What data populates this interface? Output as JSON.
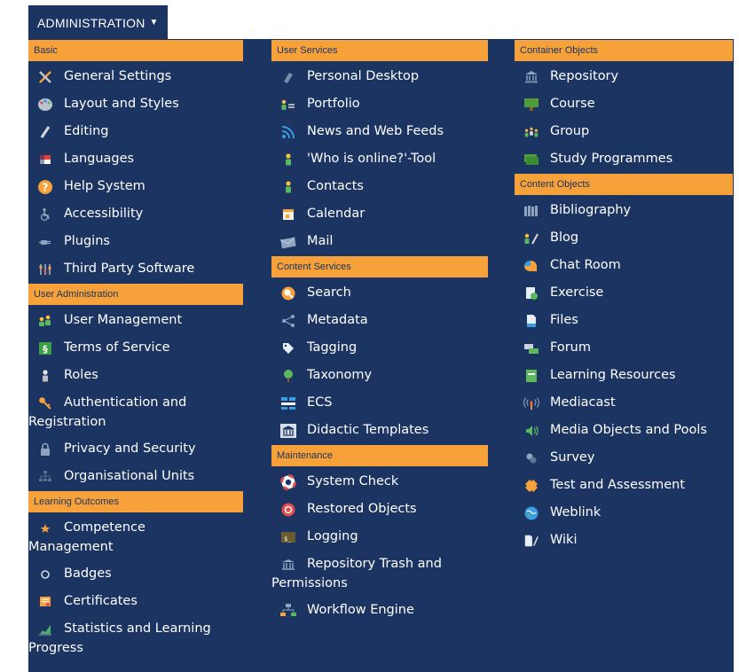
{
  "dropdown": {
    "label": "ADMINISTRATION"
  },
  "columns": [
    {
      "sections": [
        {
          "title": "Basic",
          "items": [
            {
              "label": "General Settings",
              "icon": "tools-icon"
            },
            {
              "label": "Layout and Styles",
              "icon": "palette-icon"
            },
            {
              "label": "Editing",
              "icon": "pencil-icon"
            },
            {
              "label": "Languages",
              "icon": "flag-icon"
            },
            {
              "label": "Help System",
              "icon": "help-icon"
            },
            {
              "label": "Accessibility",
              "icon": "accessibility-icon"
            },
            {
              "label": "Plugins",
              "icon": "plug-icon"
            },
            {
              "label": "Third Party Software",
              "icon": "sliders-icon"
            }
          ]
        },
        {
          "title": "User Administration",
          "items": [
            {
              "label": "User Management",
              "icon": "users-icon"
            },
            {
              "label": "Terms of Service",
              "icon": "section-icon"
            },
            {
              "label": "Roles",
              "icon": "role-icon"
            },
            {
              "label": "Authentication and",
              "cont": "Registration",
              "icon": "key-icon"
            },
            {
              "label": "Privacy and Security",
              "icon": "lock-icon"
            },
            {
              "label": "Organisational Units",
              "icon": "org-icon"
            }
          ]
        },
        {
          "title": "Learning Outcomes",
          "items": [
            {
              "label": "Competence",
              "cont": "Management",
              "icon": "star-icon"
            },
            {
              "label": "Badges",
              "icon": "badge-icon"
            },
            {
              "label": "Certificates",
              "icon": "certificate-icon"
            },
            {
              "label": "Statistics and Learning",
              "cont": "Progress",
              "icon": "chart-icon"
            }
          ]
        }
      ]
    },
    {
      "sections": [
        {
          "title": "User Services",
          "items": [
            {
              "label": "Personal Desktop",
              "icon": "desktop-icon"
            },
            {
              "label": "Portfolio",
              "icon": "portfolio-icon"
            },
            {
              "label": "News and Web Feeds",
              "icon": "rss-icon"
            },
            {
              "label": "'Who is online?'-Tool",
              "icon": "person-icon"
            },
            {
              "label": "Contacts",
              "icon": "contacts-icon"
            },
            {
              "label": "Calendar",
              "icon": "calendar-icon"
            },
            {
              "label": "Mail",
              "icon": "mail-icon"
            }
          ]
        },
        {
          "title": "Content Services",
          "items": [
            {
              "label": "Search",
              "icon": "search-icon"
            },
            {
              "label": "Metadata",
              "icon": "share-icon"
            },
            {
              "label": "Tagging",
              "icon": "tag-icon"
            },
            {
              "label": "Taxonomy",
              "icon": "tree-icon"
            },
            {
              "label": "ECS",
              "icon": "ecs-icon"
            },
            {
              "label": "Didactic Templates",
              "icon": "template-icon"
            }
          ]
        },
        {
          "title": "Maintenance",
          "items": [
            {
              "label": "System Check",
              "icon": "lifebuoy-icon"
            },
            {
              "label": "Restored Objects",
              "icon": "restore-icon"
            },
            {
              "label": "Logging",
              "icon": "terminal-icon"
            },
            {
              "label": "Repository Trash and",
              "cont": "Permissions",
              "icon": "trash-icon"
            },
            {
              "label": "Workflow Engine",
              "icon": "workflow-icon"
            }
          ]
        }
      ]
    },
    {
      "sections": [
        {
          "title": "Container Objects",
          "items": [
            {
              "label": "Repository",
              "icon": "repository-icon"
            },
            {
              "label": "Course",
              "icon": "course-icon"
            },
            {
              "label": "Group",
              "icon": "group-icon"
            },
            {
              "label": "Study Programmes",
              "icon": "programme-icon"
            }
          ]
        },
        {
          "title": "Content Objects",
          "items": [
            {
              "label": "Bibliography",
              "icon": "books-icon"
            },
            {
              "label": "Blog",
              "icon": "blog-icon"
            },
            {
              "label": "Chat Room",
              "icon": "chat-icon"
            },
            {
              "label": "Exercise",
              "icon": "exercise-icon"
            },
            {
              "label": "Files",
              "icon": "file-icon"
            },
            {
              "label": "Forum",
              "icon": "forum-icon"
            },
            {
              "label": "Learning Resources",
              "icon": "book-icon"
            },
            {
              "label": "Mediacast",
              "icon": "broadcast-icon"
            },
            {
              "label": "Media Objects and Pools",
              "icon": "media-icon"
            },
            {
              "label": "Survey",
              "icon": "survey-icon"
            },
            {
              "label": "Test and Assessment",
              "icon": "puzzle-icon"
            },
            {
              "label": "Weblink",
              "icon": "globe-icon"
            },
            {
              "label": "Wiki",
              "icon": "wiki-icon"
            }
          ]
        }
      ]
    }
  ]
}
